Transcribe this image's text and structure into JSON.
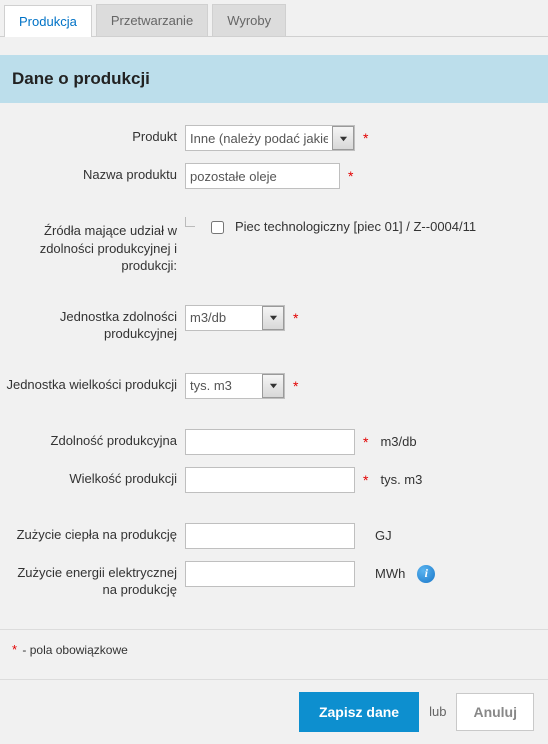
{
  "tabs": [
    {
      "label": "Produkcja",
      "active": true
    },
    {
      "label": "Przetwarzanie",
      "active": false
    },
    {
      "label": "Wyroby",
      "active": false
    }
  ],
  "section_title": "Dane o produkcji",
  "fields": {
    "product": {
      "label": "Produkt",
      "value": "Inne (należy podać jakie)",
      "required": true
    },
    "product_name": {
      "label": "Nazwa produktu",
      "value": "pozostałe oleje",
      "required": true
    },
    "sources": {
      "label": "Źródła mające udział w zdolności produkcyjnej i produkcji:",
      "option_label": "Piec technologiczny [piec 01] / Z--0004/11",
      "checked": false
    },
    "capacity_unit": {
      "label": "Jednostka zdolności produkcyjnej",
      "value": "m3/db",
      "required": true
    },
    "volume_unit": {
      "label": "Jednostka wielkości produkcji",
      "value": "tys. m3",
      "required": true
    },
    "capacity": {
      "label": "Zdolność produkcyjna",
      "value": "",
      "unit": "m3/db",
      "required": true
    },
    "volume": {
      "label": "Wielkość produkcji",
      "value": "",
      "unit": "tys. m3",
      "required": true
    },
    "heat": {
      "label": "Zużycie ciepła na produkcję",
      "value": "",
      "unit": "GJ"
    },
    "electricity": {
      "label": "Zużycie energii elektrycznej na produkcję",
      "value": "",
      "unit": "MWh"
    }
  },
  "note": {
    "asterisk": "*",
    "text": " - pola obowiązkowe"
  },
  "buttons": {
    "save": "Zapisz dane",
    "or": "lub",
    "cancel": "Anuluj"
  }
}
